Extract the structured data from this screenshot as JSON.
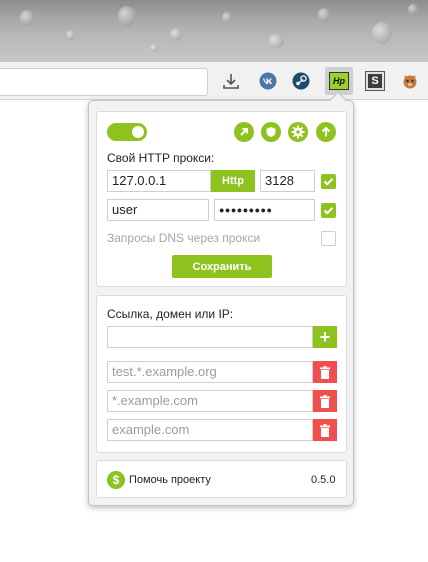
{
  "browser": {
    "toolbar_icons": [
      "download-icon",
      "vk-icon",
      "steam-icon",
      "hp-proxy-icon",
      "s-extension-icon",
      "squirrel-icon"
    ],
    "active_extension_text": "Hp",
    "s_extension_text": "S"
  },
  "popup": {
    "enabled": true,
    "header_icons": [
      "arrow-link-icon",
      "shield-icon",
      "gear-icon",
      "upload-icon"
    ],
    "proxy": {
      "label": "Свой HTTP прокси:",
      "host": "127.0.0.1",
      "type_button": "Http",
      "port": "3128",
      "port_checked": true,
      "username": "user",
      "password": "●●●●●●●●●",
      "auth_checked": true,
      "dns_label": "Запросы DNS через прокси",
      "dns_checked": false,
      "save_button": "Сохранить"
    },
    "rules": {
      "label": "Ссылка, домен или IP:",
      "input_value": "",
      "add_button": "+",
      "items": [
        "test.*.example.org",
        "*.example.com",
        "example.com"
      ]
    },
    "footer": {
      "help_label": "Помочь проекту",
      "version": "0.5.0",
      "dollar_text": "$"
    }
  },
  "colors": {
    "accent": "#8dc21f",
    "danger": "#f0504d",
    "panel": "#f2f2f2"
  }
}
